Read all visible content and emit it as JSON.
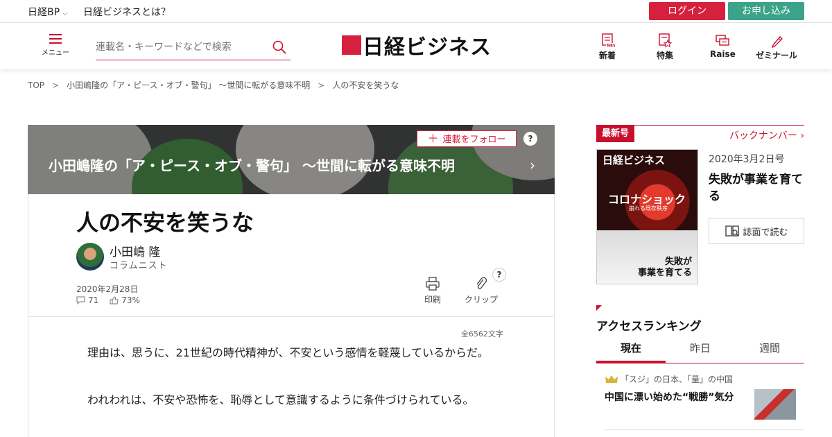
{
  "topbar": {
    "brand_link": "日経BP",
    "about_link": "日経ビジネスとは？",
    "login_label": "ログイン",
    "signup_label": "お申し込み"
  },
  "header": {
    "menu_label": "メニュー",
    "search_placeholder": "連載名・キーワードなどで検索",
    "logo_text": "日経ビジネス",
    "nav": [
      {
        "label": "新着",
        "icon": "new-doc-icon"
      },
      {
        "label": "特集",
        "icon": "feature-star-icon"
      },
      {
        "label": "Raise",
        "icon": "chat-bubbles-icon"
      },
      {
        "label": "ゼミナール",
        "icon": "pencil-icon"
      }
    ]
  },
  "breadcrumb": {
    "items": [
      "TOP",
      "小田嶋隆の「ア・ピース・オブ・警句」 ～世間に転がる意味不明",
      "人の不安を笑うな"
    ],
    "separator": ">"
  },
  "series": {
    "title": "小田嶋隆の「ア・ピース・オブ・警句」 ～世間に転がる意味不明",
    "follow_label": "連載をフォロー",
    "help": "?"
  },
  "article": {
    "title": "人の不安を笑うな",
    "author": "小田嶋 隆",
    "author_role": "コラムニスト",
    "date": "2020年2月28日",
    "comments": "71",
    "likes": "73%",
    "print_label": "印刷",
    "clip_label": "クリップ",
    "help": "?",
    "char_count": "全6562文字",
    "paragraphs": [
      "理由は、思うに、21世紀の時代精神が、不安という感情を軽蔑しているからだ。",
      "われわれは、不安や恐怖を、恥辱として意識するように条件づけられている。"
    ]
  },
  "sidebar": {
    "latest_tag": "最新号",
    "back_numbers": "バックナンバー",
    "cover": {
      "masthead": "日経ビジネス",
      "headline": "コロナショック",
      "subhead": "崩れる既存秩序",
      "bottom_line1": "失敗が",
      "bottom_line2": "事業を育てる"
    },
    "issue_date": "2020年3月2日号",
    "issue_title": "失敗が事業を育てる",
    "read_label": "誌面で読む",
    "ranking_title": "アクセスランキング",
    "ranking_tabs": [
      "現在",
      "昨日",
      "週間"
    ],
    "ranking_items": [
      {
        "sub": "「スジ」の日本、「量」の中国",
        "title": "中国に漂い始めた“戦勝”気分"
      }
    ]
  },
  "colors": {
    "accent_red": "#d6213e",
    "signup_green": "#3aa38a"
  }
}
